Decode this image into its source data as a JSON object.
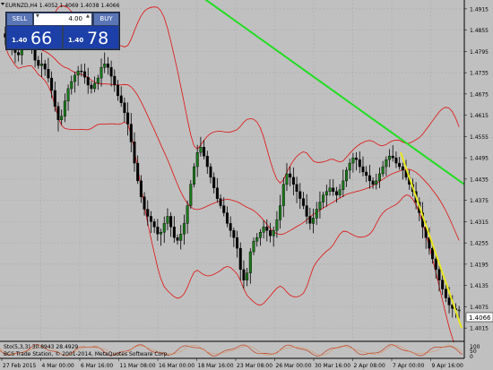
{
  "header": {
    "symbol_line": "EURNZD,H4  1.4052 1.4069 1.4038 1.4066"
  },
  "trade_panel": {
    "sell_label": "SELL",
    "buy_label": "BUY",
    "lot": "4.00",
    "sell_prefix": "1.40",
    "sell_big": "66",
    "buy_prefix": "1.40",
    "buy_big": "78"
  },
  "price_axis": {
    "labels": [
      "1.4915",
      "1.4855",
      "1.4795",
      "1.4735",
      "1.4675",
      "1.4615",
      "1.4555",
      "1.4495",
      "1.4435",
      "1.4375",
      "1.4315",
      "1.4255",
      "1.4195",
      "1.4135",
      "1.4075",
      "1.4015"
    ],
    "current": "1.4066"
  },
  "time_axis": {
    "labels": [
      "27 Feb 2015",
      "4 Mar 00:00",
      "6 Mar 16:00",
      "11 Mar 08:00",
      "16 Mar 00:00",
      "18 Mar 16:00",
      "23 Mar 08:00",
      "26 Mar 00:00",
      "30 Mar 16:00",
      "2 Apr 08:00",
      "7 Apr 00:00",
      "9 Apr 16:00"
    ]
  },
  "indicator": {
    "label": "Sto(5,3,3) 30.8943 28.4929",
    "axis_top": "100",
    "axis_mid": "50",
    "axis_bottom": "0"
  },
  "copyright": "BCS Trade Station, © 2001-2014, MetaQuotes Software Corp.",
  "chart_data": {
    "type": "candlestick",
    "ylim": [
      1.398,
      1.494
    ],
    "closes": [
      1.4835,
      1.4818,
      1.4805,
      1.4792,
      1.4785,
      1.481,
      1.4832,
      1.4828,
      1.48,
      1.477,
      1.4755,
      1.476,
      1.4745,
      1.472,
      1.4685,
      1.464,
      1.4602,
      1.4612,
      1.4655,
      1.469,
      1.471,
      1.4728,
      1.474,
      1.4738,
      1.4722,
      1.47,
      1.469,
      1.4705,
      1.472,
      1.475,
      1.476,
      1.475,
      1.4725,
      1.47,
      1.467,
      1.465,
      1.4622,
      1.459,
      1.454,
      1.448,
      1.443,
      1.4385,
      1.435,
      1.433,
      1.4315,
      1.43,
      1.428,
      1.4285,
      1.431,
      1.433,
      1.43,
      1.427,
      1.4262,
      1.428,
      1.431,
      1.436,
      1.442,
      1.447,
      1.451,
      1.4525,
      1.45,
      1.447,
      1.444,
      1.441,
      1.438,
      1.436,
      1.434,
      1.431,
      1.429,
      1.427,
      1.424,
      1.418,
      1.415,
      1.417,
      1.423,
      1.426,
      1.427,
      1.4285,
      1.43,
      1.429,
      1.4275,
      1.429,
      1.432,
      1.436,
      1.442,
      1.445,
      1.444,
      1.442,
      1.44,
      1.438,
      1.436,
      1.433,
      1.431,
      1.4325,
      1.435,
      1.437,
      1.439,
      1.44,
      1.441,
      1.44,
      1.439,
      1.4405,
      1.443,
      1.446,
      1.448,
      1.4495,
      1.449,
      1.447,
      1.4455,
      1.4445,
      1.443,
      1.442,
      1.443,
      1.445,
      1.447,
      1.449,
      1.45,
      1.4495,
      1.448,
      1.447,
      1.446,
      1.444,
      1.442,
      1.44,
      1.437,
      1.434,
      1.43,
      1.427,
      1.424,
      1.421,
      1.418,
      1.415,
      1.4125,
      1.41,
      1.408,
      1.407,
      1.4066,
      1.4066
    ],
    "resistance_line_green": {
      "from": [
        0,
        1.4985
      ],
      "to": [
        1,
        1.442
      ]
    },
    "trend_line_yellow": {
      "from": [
        0,
        1.451
      ],
      "to": [
        1,
        1.4015
      ]
    }
  }
}
